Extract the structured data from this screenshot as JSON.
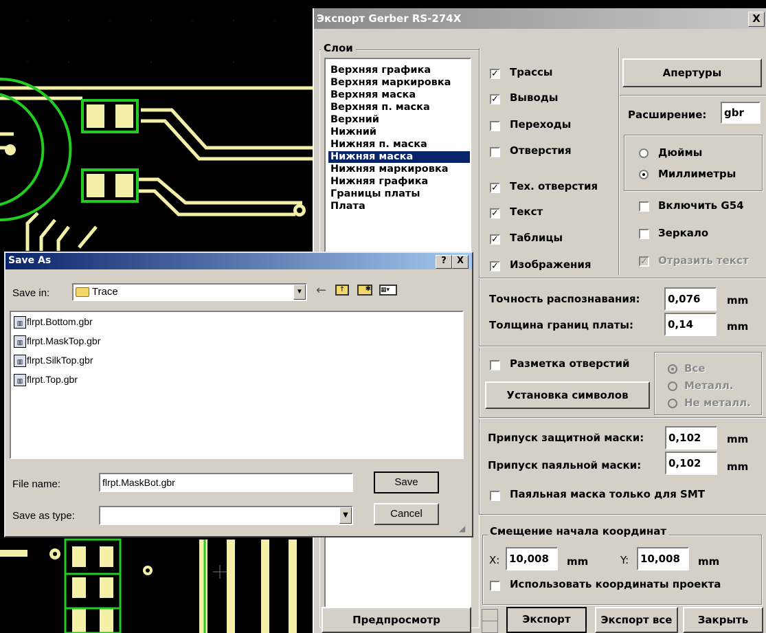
{
  "gerber": {
    "title": "Экспорт Gerber RS-274X",
    "close": "X",
    "layers_group": "Слои",
    "layers": [
      "Верхняя графика",
      "Верхняя маркировка",
      "Верхняя маска",
      "Верхняя п. маска",
      "Верхний",
      "Нижний",
      "Нижняя п. маска",
      "Нижняя маска",
      "Нижняя маркировка",
      "Нижняя графика",
      "Границы платы",
      "Плата"
    ],
    "selected_layer": "Нижняя маска",
    "options": [
      {
        "label": "Трассы",
        "checked": true
      },
      {
        "label": "Выводы",
        "checked": true
      },
      {
        "label": "Переходы",
        "checked": false
      },
      {
        "label": "Отверстия",
        "checked": false
      },
      {
        "label": "Тех. отверстия",
        "checked": true
      },
      {
        "label": "Текст",
        "checked": true
      },
      {
        "label": "Таблицы",
        "checked": true
      },
      {
        "label": "Изображения",
        "checked": true
      }
    ],
    "apertures_button": "Апертуры",
    "extension_label": "Расширение:",
    "extension_value": "gbr",
    "units": [
      {
        "label": "Дюймы",
        "selected": false
      },
      {
        "label": "Миллиметры",
        "selected": true
      }
    ],
    "include_g54": "Включить G54",
    "mirror": "Зеркало",
    "mirror_text": "Отразить текст",
    "precision_label": "Точность распознавания:",
    "precision_value": "0,076",
    "board_border_label": "Толщина границ платы:",
    "board_border_value": "0,14",
    "unit_mm": "mm",
    "drill_marking": "Разметка отверстий",
    "symbols_button": "Установка символов",
    "drill_types": [
      "Все",
      "Металл.",
      "Не металл."
    ],
    "solder_mask_label": "Припуск защитной маски:",
    "solder_mask_value": "0,102",
    "paste_mask_label": "Припуск паяльной маски:",
    "paste_mask_value": "0,102",
    "smt_only": "Паяльная маска только для SMT",
    "offset_group": "Смещение начала координат",
    "x_label": "X:",
    "x_value": "10,008",
    "y_label": "Y:",
    "y_value": "10,008",
    "use_project_coords": "Использовать координаты проекта",
    "preview_button": "Предпросмотр",
    "export_button": "Экспорт",
    "export_all_button": "Экспорт все",
    "close_button": "Закрыть"
  },
  "saveas": {
    "title": "Save As",
    "help": "?",
    "close": "X",
    "save_in_label": "Save in:",
    "save_in_value": "Trace",
    "files": [
      "flrpt.Bottom.gbr",
      "flrpt.MaskTop.gbr",
      "flrpt.SilkTop.gbr",
      "flrpt.Top.gbr"
    ],
    "file_name_label": "File name:",
    "file_name_value": "flrpt.MaskBot.gbr",
    "save_type_label": "Save as type:",
    "save_type_value": "",
    "save_button": "Save",
    "cancel_button": "Cancel",
    "toolbar_icons": [
      "back-arrow-icon",
      "up-folder-icon",
      "new-folder-icon",
      "view-menu-icon"
    ]
  },
  "colors": {
    "trace": "#f5f0a8",
    "pad_outline": "#22cc22",
    "selection": "#0a246a",
    "saveas_title": "#0a246a"
  }
}
